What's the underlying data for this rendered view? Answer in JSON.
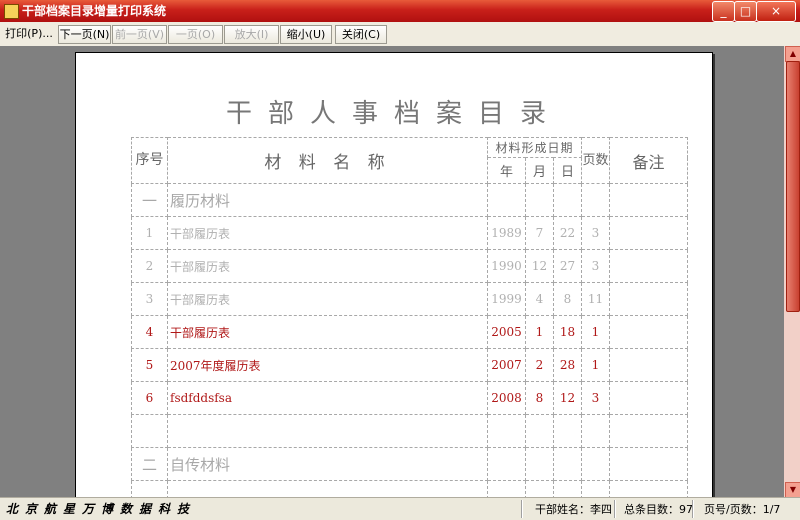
{
  "window": {
    "title": "干部档案目录增量打印系统",
    "controls": [
      "_",
      "□",
      "×"
    ]
  },
  "toolbar": {
    "print": "打印(P)...",
    "next_page": "下一页(N)",
    "prev_page": "前一页(V)",
    "one_page": "一页(O)",
    "zoom_in": "放大(I)",
    "zoom_out": "缩小(U)",
    "close": "关闭(C)"
  },
  "document": {
    "title": "干部人事档案目录",
    "headers": {
      "seq": "序号",
      "material_name": "材 料 名 称",
      "formation_date": "材料形成日期",
      "year": "年",
      "month": "月",
      "day": "日",
      "pages": "页数",
      "remarks": "备注"
    },
    "sections": [
      {
        "number": "一",
        "name": "履历材料",
        "rows": [
          {
            "seq": "1",
            "name": "干部履历表",
            "year": "1989",
            "month": "7",
            "day": "22",
            "pages": "3",
            "state": "printed"
          },
          {
            "seq": "2",
            "name": "干部履历表",
            "year": "1990",
            "month": "12",
            "day": "27",
            "pages": "3",
            "state": "printed"
          },
          {
            "seq": "3",
            "name": "干部履历表",
            "year": "1999",
            "month": "4",
            "day": "8",
            "pages": "11",
            "state": "printed"
          },
          {
            "seq": "4",
            "name": "干部履历表",
            "year": "2005",
            "month": "1",
            "day": "18",
            "pages": "1",
            "state": "new"
          },
          {
            "seq": "5",
            "name": "2007年度履历表",
            "year": "2007",
            "month": "2",
            "day": "28",
            "pages": "1",
            "state": "new"
          },
          {
            "seq": "6",
            "name": "fsdfddsfsa",
            "year": "2008",
            "month": "8",
            "day": "12",
            "pages": "3",
            "state": "new"
          }
        ]
      },
      {
        "number": "二",
        "name": "自传材料",
        "rows": []
      }
    ]
  },
  "statusbar": {
    "company": "北京航星万博数据科技",
    "cadre_name": "干部姓名：李四",
    "total_entries": "总条目数：97",
    "page_info": "页号/页数：1/7"
  },
  "colors": {
    "titlebar": "#c8201a",
    "printed_text": "#b0b0b0",
    "new_text": "#b01818",
    "viewer_bg": "#808080"
  }
}
